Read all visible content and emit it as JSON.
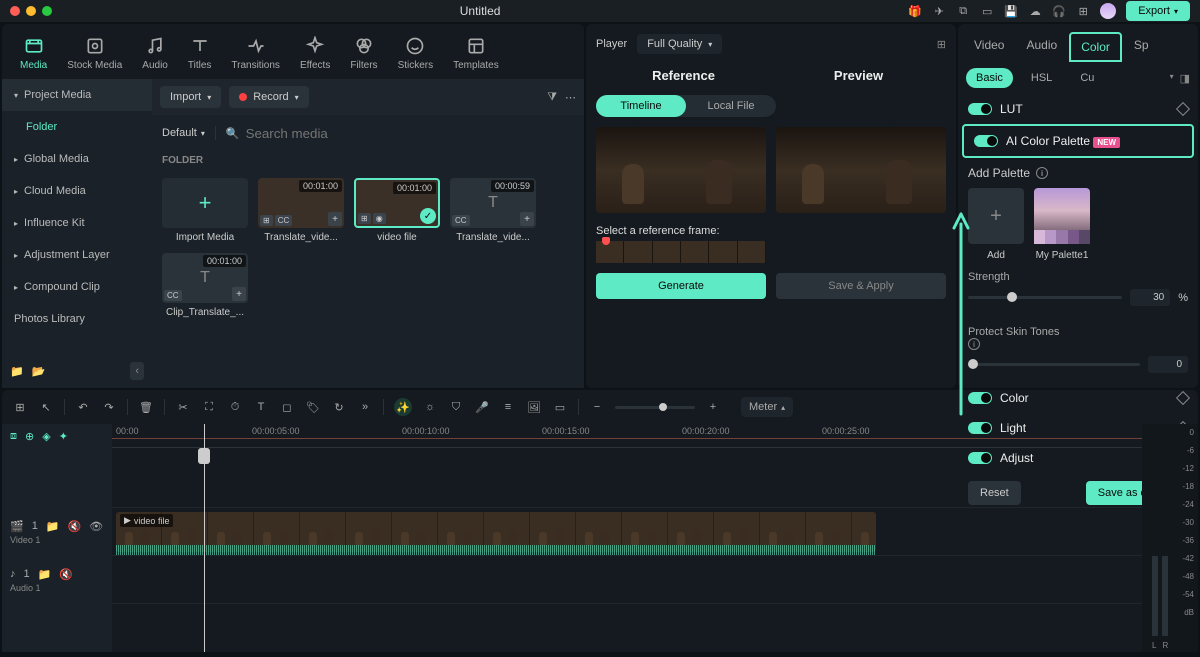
{
  "titlebar": {
    "title": "Untitled",
    "export": "Export"
  },
  "top_tabs": [
    {
      "k": "media",
      "label": "Media"
    },
    {
      "k": "stock",
      "label": "Stock Media"
    },
    {
      "k": "audio",
      "label": "Audio"
    },
    {
      "k": "titles",
      "label": "Titles"
    },
    {
      "k": "transitions",
      "label": "Transitions"
    },
    {
      "k": "effects",
      "label": "Effects"
    },
    {
      "k": "filters",
      "label": "Filters"
    },
    {
      "k": "stickers",
      "label": "Stickers"
    },
    {
      "k": "templates",
      "label": "Templates"
    }
  ],
  "import_label": "Import",
  "record_label": "Record",
  "sidebar": {
    "project": "Project Media",
    "folder": "Folder",
    "items": [
      "Global Media",
      "Cloud Media",
      "Influence Kit",
      "Adjustment Layer",
      "Compound Clip",
      "Photos Library"
    ]
  },
  "default_label": "Default",
  "search_placeholder": "Search media",
  "folder_heading": "FOLDER",
  "clips": [
    {
      "name": "Import Media",
      "type": "import"
    },
    {
      "name": "Translate_vide...",
      "type": "video",
      "dur": "00:01:00",
      "cc": true
    },
    {
      "name": "video file",
      "type": "video",
      "dur": "00:01:00",
      "selected": true
    },
    {
      "name": "Translate_vide...",
      "type": "text",
      "dur": "00:00:59",
      "cc": true
    },
    {
      "name": "Clip_Translate_...",
      "type": "text",
      "dur": "00:01:00",
      "cc": true
    }
  ],
  "player": {
    "label": "Player",
    "quality": "Full Quality"
  },
  "ref_prev": {
    "ref": "Reference",
    "prev": "Preview",
    "timeline": "Timeline",
    "local": "Local File"
  },
  "select_ref": "Select a reference frame:",
  "generate": "Generate",
  "save_apply": "Save & Apply",
  "right_tabs": [
    "Video",
    "Audio",
    "Color",
    "Sp"
  ],
  "subtabs": [
    "Basic",
    "HSL",
    "Cu"
  ],
  "lut": "LUT",
  "ai_palette": "AI Color Palette",
  "new_badge": "NEW",
  "add_palette": "Add Palette",
  "palettes": [
    {
      "name": "Add"
    },
    {
      "name": "My Palette1"
    }
  ],
  "strength": {
    "label": "Strength",
    "value": "30",
    "unit": "%"
  },
  "protect": {
    "label": "Protect Skin Tones",
    "value": "0"
  },
  "color_row": "Color",
  "light_row": "Light",
  "adjust_row": "Adjust",
  "reset": "Reset",
  "save_custom": "Save as custom",
  "timeline": {
    "meter": "Meter",
    "ticks": [
      "00:00",
      "00:00:05:00",
      "00:00:10:00",
      "00:00:15:00",
      "00:00:20:00",
      "00:00:25:00"
    ],
    "video_track": "Video 1",
    "audio_track": "Audio 1",
    "clip_label": "video file",
    "db_scale": [
      "0",
      "-6",
      "-12",
      "-18",
      "-24",
      "-30",
      "-36",
      "-42",
      "-48",
      "-54",
      "dB"
    ],
    "lr": {
      "l": "L",
      "r": "R"
    }
  }
}
